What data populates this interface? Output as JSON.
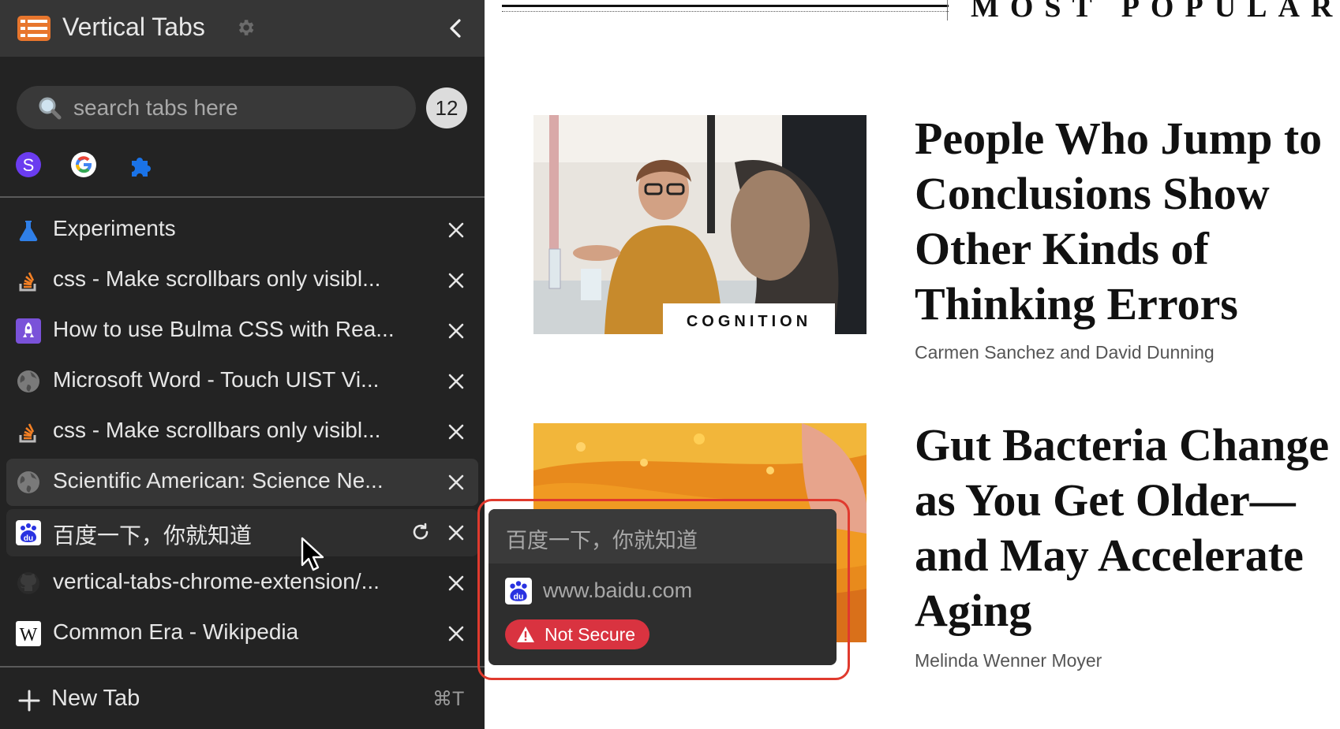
{
  "sidebar": {
    "app_title": "Vertical Tabs",
    "search": {
      "placeholder": "search tabs here",
      "value": ""
    },
    "tab_count": "12",
    "pinned": [
      {
        "name": "pinned-s-app",
        "letter": "S",
        "color": "#6b3cf0"
      },
      {
        "name": "pinned-google",
        "letter": "G",
        "color": "#4285f4"
      },
      {
        "name": "pinned-extensions",
        "icon": "puzzle-icon",
        "color": "#1a73e8"
      }
    ],
    "tabs": [
      {
        "title": "Experiments",
        "icon": "flask-icon"
      },
      {
        "title": "css - Make scrollbars only visibl...",
        "icon": "stackoverflow-icon"
      },
      {
        "title": "How to use Bulma CSS with Rea...",
        "icon": "rocket-icon"
      },
      {
        "title": "Microsoft Word - Touch UIST Vi...",
        "icon": "globe-icon"
      },
      {
        "title": "css - Make scrollbars only visibl...",
        "icon": "stackoverflow-icon"
      },
      {
        "title": "Scientific American: Science Ne...",
        "icon": "globe-icon",
        "state": "active"
      },
      {
        "title": "百度一下，你就知道",
        "icon": "baidu-icon",
        "state": "hover"
      },
      {
        "title": "vertical-tabs-chrome-extension/...",
        "icon": "github-icon"
      },
      {
        "title": "Common Era - Wikipedia",
        "icon": "wikipedia-icon"
      }
    ],
    "new_tab": {
      "label": "New Tab",
      "shortcut": "⌘T"
    }
  },
  "content": {
    "section_title": "MOST POPULAR",
    "articles": [
      {
        "category": "COGNITION",
        "headline": "People Who Jump to Conclusions Show Other Kinds of Thinking Errors",
        "byline": "Carmen Sanchez and David Dunning"
      },
      {
        "headline": "Gut Bacteria Change as You Get Older—and May Accelerate Aging",
        "byline": "Melinda Wenner Moyer"
      }
    ]
  },
  "hover_card": {
    "title": "百度一下，你就知道",
    "url": "www.baidu.com",
    "security": "Not Secure"
  },
  "colors": {
    "sidebar_bg": "#232323",
    "highlight": "#e03a2e",
    "not_secure": "#d93340"
  }
}
